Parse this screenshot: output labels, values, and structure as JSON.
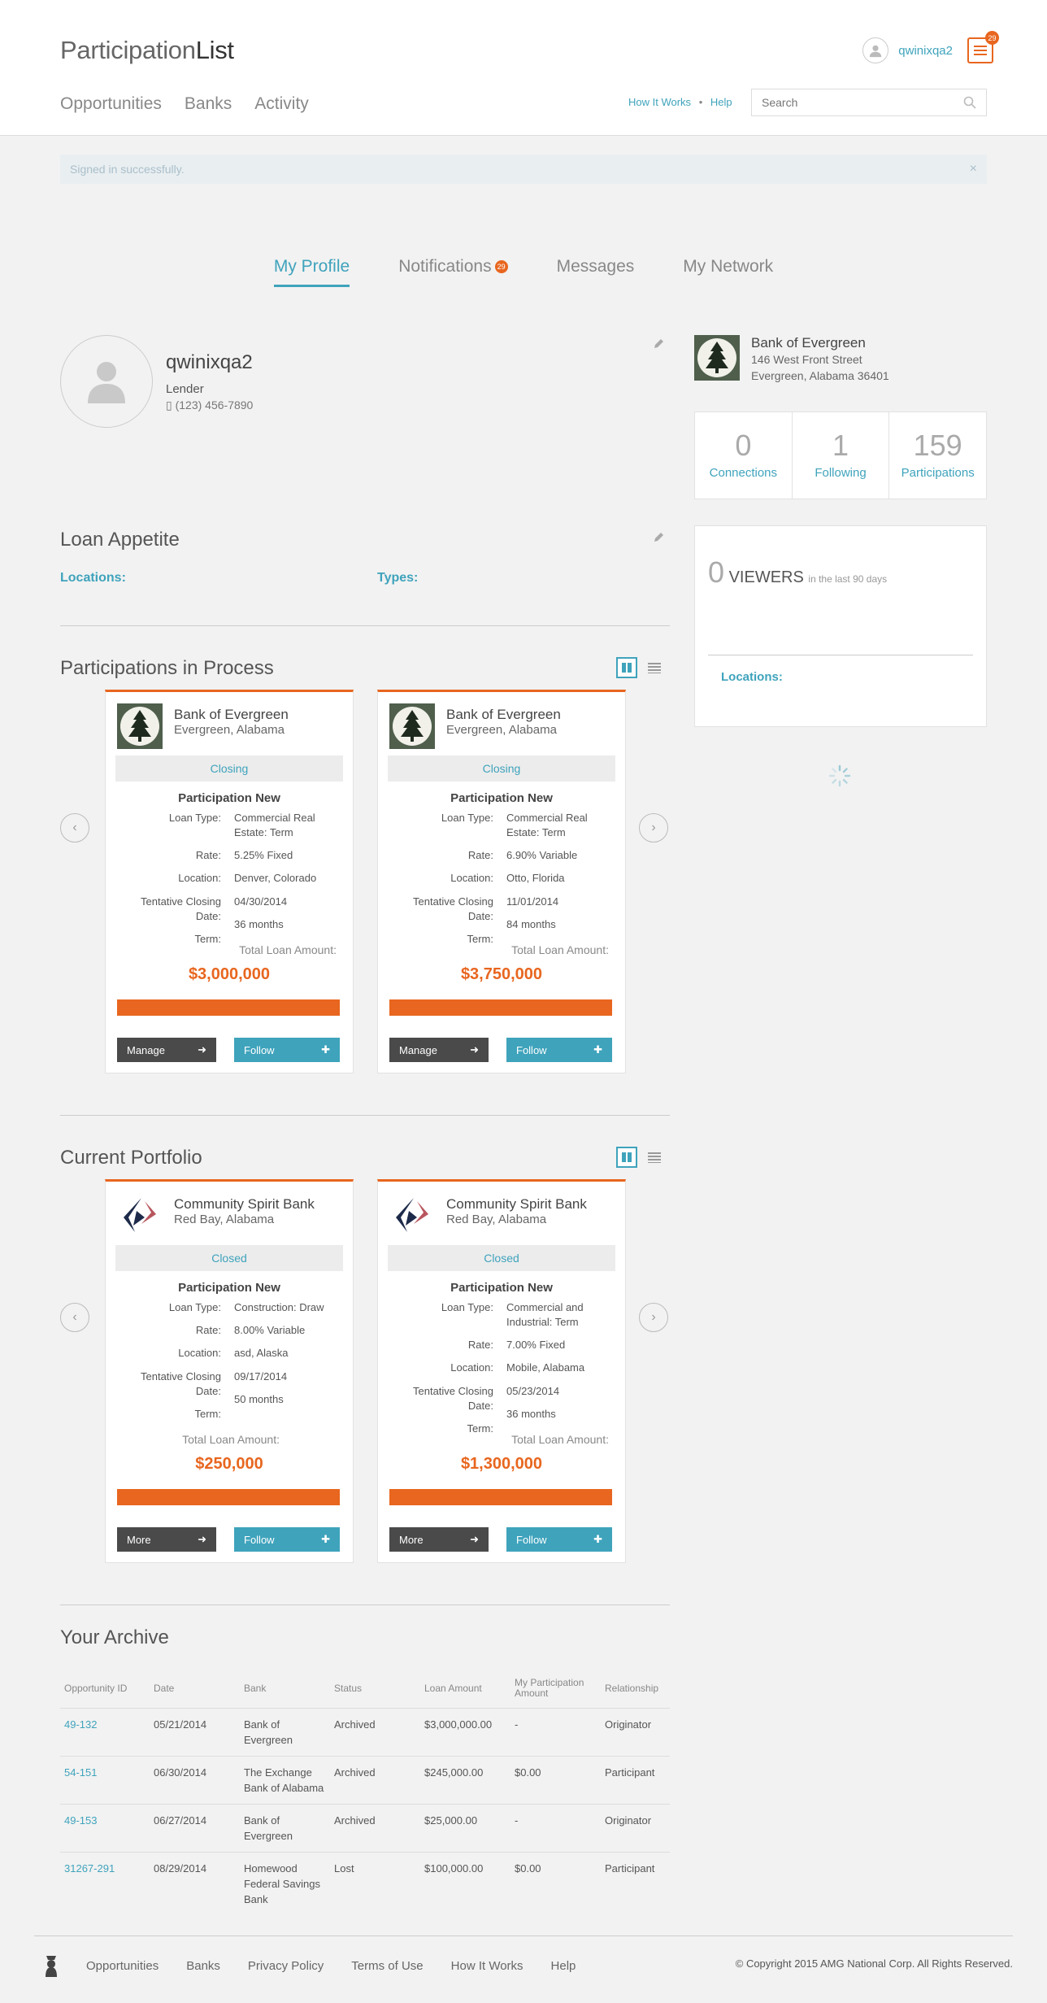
{
  "header": {
    "logo_light": "Participation",
    "logo_bold": "List",
    "nav": [
      "Opportunities",
      "Banks",
      "Activity"
    ],
    "username": "qwinixqa2",
    "menu_badge": "29",
    "help_links": [
      "How It Works",
      "Help"
    ],
    "help_separator": "•",
    "search_placeholder": "Search"
  },
  "alert": {
    "text": "Signed in successfully.",
    "close": "×"
  },
  "tabs": [
    {
      "label": "My Profile",
      "active": true
    },
    {
      "label": "Notifications",
      "badge": "29"
    },
    {
      "label": "Messages"
    },
    {
      "label": "My Network"
    }
  ],
  "profile": {
    "name": "qwinixqa2",
    "role": "Lender",
    "phone": "(123) 456-7890",
    "phone_icon": "▯"
  },
  "bank": {
    "name": "Bank of Evergreen",
    "address1": "146 West Front Street",
    "address2": "Evergreen, Alabama 36401"
  },
  "stats": [
    {
      "num": "0",
      "label": "Connections"
    },
    {
      "num": "1",
      "label": "Following"
    },
    {
      "num": "159",
      "label": "Participations"
    }
  ],
  "viewers": {
    "count": "0",
    "label": "VIEWERS",
    "sub": "in the last 90 days",
    "locations": "Locations:"
  },
  "loan_appetite": {
    "title": "Loan Appetite",
    "locations": "Locations:",
    "types": "Types:"
  },
  "in_process": {
    "title": "Participations in Process",
    "cards": [
      {
        "bank": "Bank of Evergreen",
        "location": "Evergreen, Alabama",
        "status": "Closing",
        "title": "Participation New",
        "loan_type": "Commercial Real Estate: Term",
        "rate": "5.25% Fixed",
        "loc": "Denver, Colorado",
        "closing": "04/30/2014",
        "term": "36 months",
        "amount": "$3,000,000",
        "btn1": "Manage",
        "btn2": "Follow"
      },
      {
        "bank": "Bank of Evergreen",
        "location": "Evergreen, Alabama",
        "status": "Closing",
        "title": "Participation New",
        "loan_type": "Commercial Real Estate: Term",
        "rate": "6.90% Variable",
        "loc": "Otto, Florida",
        "closing": "11/01/2014",
        "term": "84 months",
        "amount": "$3,750,000",
        "btn1": "Manage",
        "btn2": "Follow"
      }
    ]
  },
  "portfolio": {
    "title": "Current Portfolio",
    "cards": [
      {
        "bank": "Community Spirit Bank",
        "location": "Red Bay, Alabama",
        "status": "Closed",
        "title": "Participation New",
        "loan_type": "Construction: Draw",
        "rate": "8.00% Variable",
        "loc": "asd, Alaska",
        "closing": "09/17/2014",
        "term": "50 months",
        "amount": "$250,000",
        "btn1": "More",
        "btn2": "Follow"
      },
      {
        "bank": "Community Spirit Bank",
        "location": "Red Bay, Alabama",
        "status": "Closed",
        "title": "Participation New",
        "loan_type": "Commercial and Industrial: Term",
        "rate": "7.00% Fixed",
        "loc": "Mobile, Alabama",
        "closing": "05/23/2014",
        "term": "36 months",
        "amount": "$1,300,000",
        "btn1": "More",
        "btn2": "Follow"
      }
    ]
  },
  "card_labels": {
    "loan_type": "Loan Type:",
    "rate": "Rate:",
    "location": "Location:",
    "closing": "Tentative Closing Date:",
    "term": "Term:",
    "total": "Total Loan Amount:"
  },
  "archive": {
    "title": "Your Archive",
    "headers": [
      "Opportunity ID",
      "Date",
      "Bank",
      "Status",
      "Loan Amount",
      "My Participation Amount",
      "Relationship"
    ],
    "rows": [
      [
        "49-132",
        "05/21/2014",
        "Bank of Evergreen",
        "Archived",
        "$3,000,000.00",
        "-",
        "Originator"
      ],
      [
        "54-151",
        "06/30/2014",
        "The Exchange Bank of Alabama",
        "Archived",
        "$245,000.00",
        "$0.00",
        "Participant"
      ],
      [
        "49-153",
        "06/27/2014",
        "Bank of Evergreen",
        "Archived",
        "$25,000.00",
        "-",
        "Originator"
      ],
      [
        "31267-291",
        "08/29/2014",
        "Homewood Federal Savings Bank",
        "Lost",
        "$100,000.00",
        "$0.00",
        "Participant"
      ]
    ]
  },
  "footer": {
    "links": [
      "Opportunities",
      "Banks",
      "Privacy Policy",
      "Terms of Use",
      "How It Works",
      "Help"
    ],
    "copyright": "© Copyright 2015 AMG National Corp. All Rights Reserved."
  },
  "colors": {
    "accent": "#3fa3bc",
    "orange": "#e8661f",
    "dark_button": "#4a4a4a"
  }
}
